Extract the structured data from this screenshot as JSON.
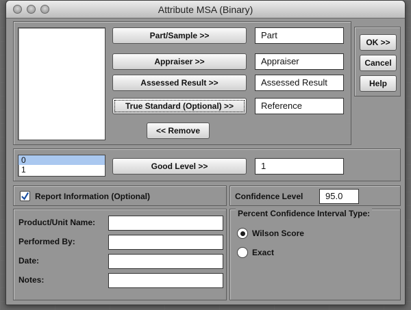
{
  "window": {
    "title": "Attribute MSA (Binary)"
  },
  "top": {
    "part_button": "Part/Sample >>",
    "part_value": "Part",
    "appraiser_button": "Appraiser >>",
    "appraiser_value": "Appraiser",
    "assessed_button": "Assessed Result >>",
    "assessed_value": "Assessed Result",
    "standard_button": "True Standard (Optional) >>",
    "standard_value": "Reference",
    "remove_button": "<< Remove"
  },
  "side": {
    "ok": "OK >>",
    "cancel": "Cancel",
    "help": "Help"
  },
  "good": {
    "levels": [
      "0",
      "1"
    ],
    "selected_index": 0,
    "button": "Good Level >>",
    "value": "1"
  },
  "report": {
    "checkbox_label": "Report Information (Optional)",
    "checked": true,
    "fields": [
      {
        "label": "Product/Unit Name:",
        "value": ""
      },
      {
        "label": "Performed By:",
        "value": ""
      },
      {
        "label": "Date:",
        "value": ""
      },
      {
        "label": "Notes:",
        "value": ""
      }
    ]
  },
  "confidence": {
    "label": "Confidence Level",
    "value": "95.0",
    "interval_group": "Percent Confidence Interval Type:",
    "options": [
      {
        "label": "Wilson Score",
        "selected": true
      },
      {
        "label": "Exact",
        "selected": false
      }
    ]
  }
}
